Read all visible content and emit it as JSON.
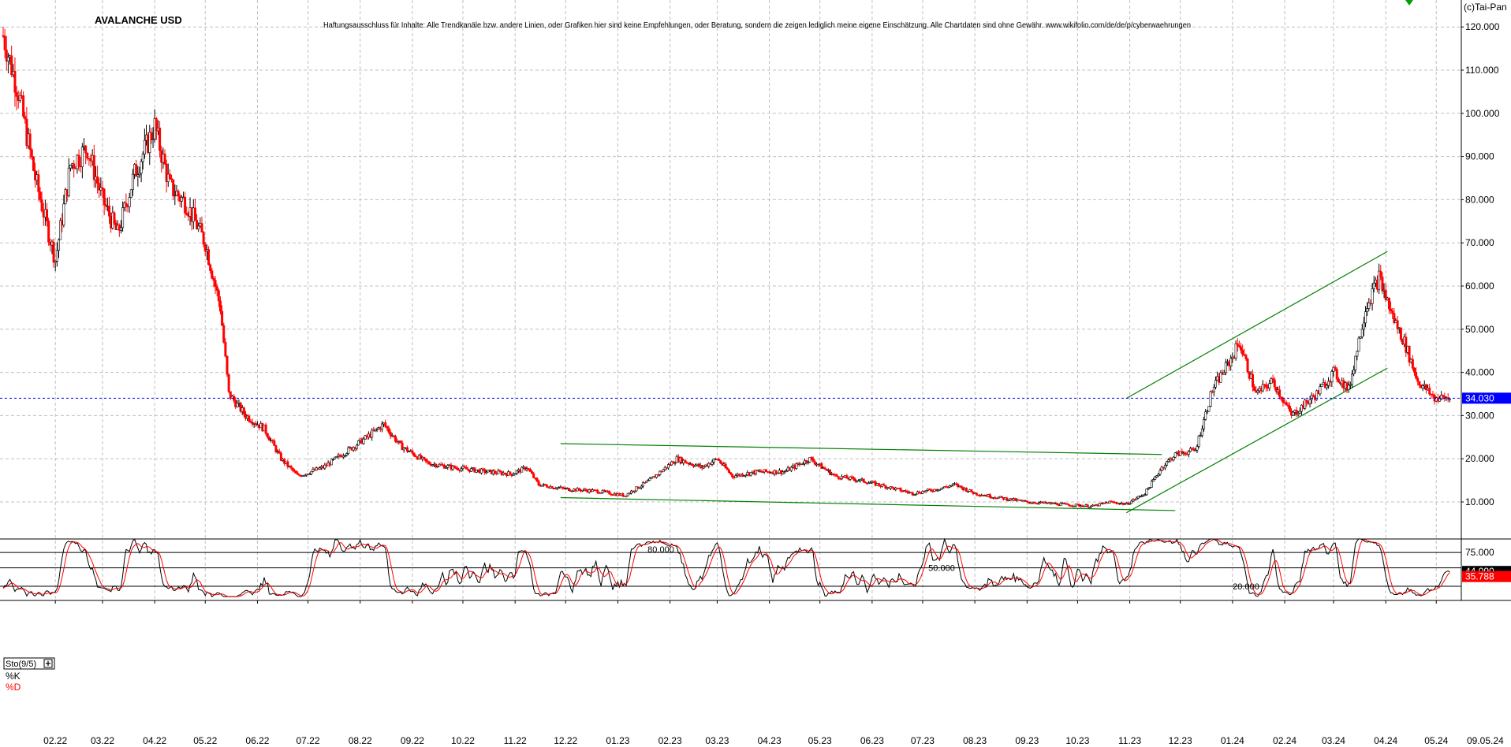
{
  "header": {
    "title": "AVALANCHE USD",
    "disclaimer": "Haftungsausschluss für Inhalte: Alle Trendkanäle bzw. andere Linien, oder Grafiken hier sind keine Empfehlungen, oder Beratung, sondern die zeigen lediglich meine eigene Einschätzung. Alle Chartdaten sind ohne Gewähr. www.wikifolio.com/de/de/p/cyberwaehrungen",
    "copyright": "(c)Tai-Pan"
  },
  "colors": {
    "bull": "#000000",
    "bear": "#ff0000",
    "trendline": "#008000",
    "last_price": "#0000ff",
    "k_line": "#000000",
    "d_line": "#ff0000",
    "grid": "#c0c0c0"
  },
  "chart_data": [
    {
      "type": "candlestick",
      "title": "AVALANCHE USD",
      "y_ticks": [
        "10.000",
        "20.000",
        "30.000",
        "40.000",
        "50.000",
        "60.000",
        "70.000",
        "80.000",
        "90.000",
        "100.000",
        "110.000",
        "120.000"
      ],
      "ylim": [
        0,
        125
      ],
      "x_ticks": [
        "02.22",
        "03.22",
        "04.22",
        "05.22",
        "06.22",
        "07.22",
        "08.22",
        "09.22",
        "10.22",
        "11.22",
        "12.22",
        "01.23",
        "02.23",
        "03.23",
        "04.23",
        "05.23",
        "06.23",
        "07.23",
        "08.23",
        "09.23",
        "10.23",
        "11.23",
        "12.23",
        "01.24",
        "02.24",
        "03.24",
        "04.24",
        "05.24"
      ],
      "x_end_label": "09.05.24",
      "grid": true,
      "last_price": 34.03,
      "last_price_label": "34.030",
      "price_path": [
        [
          "2022-01-01",
          118
        ],
        [
          "2022-01-10",
          105
        ],
        [
          "2022-01-20",
          85
        ],
        [
          "2022-02-01",
          66
        ],
        [
          "2022-02-10",
          88
        ],
        [
          "2022-02-20",
          92
        ],
        [
          "2022-03-01",
          80
        ],
        [
          "2022-03-10",
          72
        ],
        [
          "2022-03-20",
          86
        ],
        [
          "2022-04-01",
          97
        ],
        [
          "2022-04-10",
          83
        ],
        [
          "2022-04-20",
          79
        ],
        [
          "2022-05-01",
          70
        ],
        [
          "2022-05-10",
          55
        ],
        [
          "2022-05-15",
          35
        ],
        [
          "2022-05-25",
          30
        ],
        [
          "2022-06-05",
          27
        ],
        [
          "2022-06-15",
          20
        ],
        [
          "2022-06-25",
          16
        ],
        [
          "2022-07-10",
          18
        ],
        [
          "2022-07-25",
          22
        ],
        [
          "2022-08-05",
          25
        ],
        [
          "2022-08-15",
          28
        ],
        [
          "2022-08-25",
          23
        ],
        [
          "2022-09-10",
          19
        ],
        [
          "2022-09-25",
          18
        ],
        [
          "2022-10-15",
          17
        ],
        [
          "2022-10-30",
          16.5
        ],
        [
          "2022-11-08",
          18
        ],
        [
          "2022-11-15",
          14
        ],
        [
          "2022-12-01",
          13
        ],
        [
          "2022-12-20",
          12.5
        ],
        [
          "2023-01-05",
          11.5
        ],
        [
          "2023-01-20",
          15
        ],
        [
          "2023-02-05",
          20
        ],
        [
          "2023-02-20",
          18
        ],
        [
          "2023-03-01",
          20
        ],
        [
          "2023-03-10",
          16
        ],
        [
          "2023-03-25",
          17
        ],
        [
          "2023-04-10",
          17
        ],
        [
          "2023-04-25",
          20
        ],
        [
          "2023-05-10",
          16
        ],
        [
          "2023-05-25",
          15
        ],
        [
          "2023-06-10",
          13.5
        ],
        [
          "2023-06-25",
          12
        ],
        [
          "2023-07-10",
          13
        ],
        [
          "2023-07-20",
          14
        ],
        [
          "2023-08-01",
          12
        ],
        [
          "2023-08-15",
          11
        ],
        [
          "2023-09-01",
          10
        ],
        [
          "2023-09-20",
          9.5
        ],
        [
          "2023-10-10",
          9
        ],
        [
          "2023-10-20",
          10
        ],
        [
          "2023-10-30",
          9.5
        ],
        [
          "2023-11-10",
          12
        ],
        [
          "2023-11-20",
          18
        ],
        [
          "2023-11-28",
          21
        ],
        [
          "2023-12-10",
          22
        ],
        [
          "2023-12-20",
          36
        ],
        [
          "2023-12-31",
          43
        ],
        [
          "2024-01-05",
          47
        ],
        [
          "2024-01-15",
          35
        ],
        [
          "2024-01-25",
          38
        ],
        [
          "2024-02-05",
          30
        ],
        [
          "2024-02-20",
          35
        ],
        [
          "2024-03-01",
          40
        ],
        [
          "2024-03-10",
          36
        ],
        [
          "2024-03-20",
          55
        ],
        [
          "2024-03-28",
          62
        ],
        [
          "2024-04-05",
          53
        ],
        [
          "2024-04-12",
          47
        ],
        [
          "2024-04-20",
          38
        ],
        [
          "2024-04-30",
          34
        ],
        [
          "2024-05-09",
          34.03
        ]
      ],
      "trendlines": [
        {
          "from": [
            "2022-11-28",
            23.5
          ],
          "to": [
            "2023-11-20",
            21
          ]
        },
        {
          "from": [
            "2022-11-28",
            11
          ],
          "to": [
            "2023-11-28",
            8
          ]
        },
        {
          "from": [
            "2023-10-30",
            34
          ],
          "to": [
            "2024-04-02",
            68
          ]
        },
        {
          "from": [
            "2023-10-30",
            7.5
          ],
          "to": [
            "2024-04-02",
            41
          ]
        }
      ]
    },
    {
      "type": "line",
      "title": "Sto(9/5)",
      "series": [
        {
          "name": "%K",
          "color": "#000000"
        },
        {
          "name": "%D",
          "color": "#ff0000"
        }
      ],
      "ylim": [
        0,
        100
      ],
      "y_ticks": [
        "75.000"
      ],
      "reference_levels": [
        80,
        50,
        20
      ],
      "reference_labels": [
        "80.000",
        "50.000",
        "20.000"
      ],
      "last_k": 44.09,
      "last_k_label": "44.090",
      "last_d": 35.788,
      "last_d_label": "35.788"
    }
  ]
}
